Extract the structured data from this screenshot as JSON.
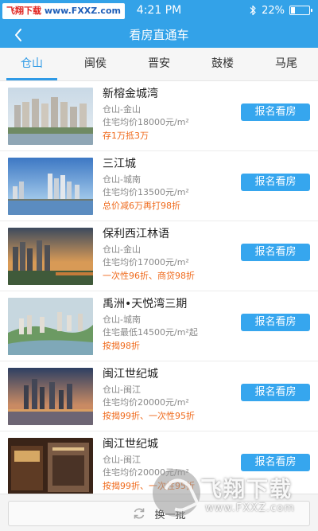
{
  "watermark_top": {
    "part1": "飞翔下载",
    "part2": "www.FXXZ.com"
  },
  "status_bar": {
    "time": "4:21 PM",
    "battery_text": "22%",
    "battery_level": 0.22,
    "bluetooth_icon": "bluetooth-icon"
  },
  "nav": {
    "back_icon": "chevron-left-icon",
    "title": "看房直通车"
  },
  "tabs": [
    {
      "label": "仓山",
      "active": true
    },
    {
      "label": "闽侯",
      "active": false
    },
    {
      "label": "晋安",
      "active": false
    },
    {
      "label": "鼓楼",
      "active": false
    },
    {
      "label": "马尾",
      "active": false
    }
  ],
  "listings": [
    {
      "name": "新榕金城湾",
      "area": "仓山-金山",
      "price": "住宅均价18000元/m²",
      "promo": "存1万抵3万",
      "button": "报名看房"
    },
    {
      "name": "三江城",
      "area": "仓山-城南",
      "price": "住宅均价13500元/m²",
      "promo": "总价减6万再打98折",
      "button": "报名看房"
    },
    {
      "name": "保利西江林语",
      "area": "仓山-金山",
      "price": "住宅均价17000元/m²",
      "promo": "一次性96折、商贷98折",
      "button": "报名看房"
    },
    {
      "name": "禹洲•天悦湾三期",
      "area": "仓山-城南",
      "price": "住宅最低14500元/m²起",
      "promo": "按揭98折",
      "button": "报名看房"
    },
    {
      "name": "闽江世纪城",
      "area": "仓山-闽江",
      "price": "住宅均价20000元/m²",
      "promo": "按揭99折、一次性95折",
      "button": "报名看房"
    },
    {
      "name": "闽江世纪城",
      "area": "仓山-闽江",
      "price": "住宅均价20000元/m²",
      "promo": "按揭99折、一次性95折",
      "button": "报名看房"
    }
  ],
  "bottom": {
    "change_label": "换一批",
    "refresh_icon": "refresh-icon"
  },
  "watermark_bottom": {
    "name": "飞翔下载",
    "url": "www.FXXZ.com"
  },
  "colors": {
    "brand_blue": "#33a2e8",
    "button_blue": "#36a6ee",
    "promo_orange": "#ef6a1c"
  }
}
